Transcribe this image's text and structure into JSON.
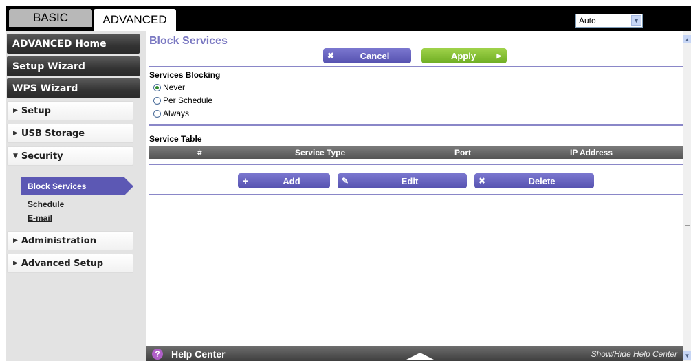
{
  "tabs": {
    "basic": "BASIC",
    "advanced": "ADVANCED"
  },
  "language_select": {
    "value": "Auto"
  },
  "sidebar": {
    "advanced_home": "ADVANCED Home",
    "setup_wizard": "Setup Wizard",
    "wps_wizard": "WPS Wizard",
    "setup": "Setup",
    "usb_storage": "USB Storage",
    "security": "Security",
    "security_items": [
      "Block Services",
      "Schedule",
      "E-mail"
    ],
    "administration": "Administration",
    "advanced_setup": "Advanced Setup"
  },
  "main": {
    "title": "Block Services",
    "cancel": "Cancel",
    "apply": "Apply",
    "services_blocking_label": "Services Blocking",
    "radio_options": [
      "Never",
      "Per Schedule",
      "Always"
    ],
    "radio_selected": "Never",
    "service_table_label": "Service Table",
    "table_headers": [
      "#",
      "Service Type",
      "Port",
      "IP Address"
    ],
    "add": "Add",
    "edit": "Edit",
    "delete": "Delete"
  },
  "help": {
    "title": "Help Center",
    "toggle": "Show/Hide Help Center"
  },
  "colors": {
    "accent_purple": "#5c58b4",
    "apply_green": "#7ab82e",
    "title_purple": "#7a78c2"
  }
}
